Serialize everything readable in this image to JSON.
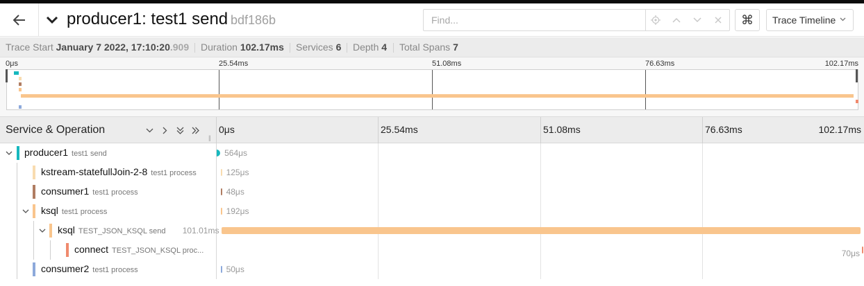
{
  "header": {
    "title": "producer1: test1 send",
    "trace_id": "bdf186b",
    "find_placeholder": "Find...",
    "kbd_symbol": "⌘",
    "view_selector": "Trace Timeline"
  },
  "stats": {
    "trace_start_label": "Trace Start",
    "trace_start_value": "January 7 2022, 17:10:20",
    "trace_start_ms": ".909",
    "duration_label": "Duration",
    "duration_value": "102.17ms",
    "services_label": "Services",
    "services_value": "6",
    "depth_label": "Depth",
    "depth_value": "4",
    "total_spans_label": "Total Spans",
    "total_spans_value": "7"
  },
  "minimap": {
    "ticks": [
      "0μs",
      "25.54ms",
      "51.08ms",
      "76.63ms",
      "102.17ms"
    ]
  },
  "timeline": {
    "column_title": "Service & Operation",
    "ticks": [
      "0μs",
      "25.54ms",
      "51.08ms",
      "76.63ms",
      "102.17ms"
    ]
  },
  "spans": [
    {
      "service": "producer1",
      "operation": "test1 send",
      "duration": "564μs",
      "color": "#17b8be",
      "start_pct": 0.0,
      "width_pct": 0.55
    },
    {
      "service": "kstream-statefullJoin-2-8",
      "operation": "test1 process",
      "duration": "125μs",
      "color": "#f8dcb0",
      "start_pct": 0.6,
      "width_pct": 0.12
    },
    {
      "service": "consumer1",
      "operation": "test1 process",
      "duration": "48μs",
      "color": "#b07d62",
      "start_pct": 0.6,
      "width_pct": 0.05
    },
    {
      "service": "ksql",
      "operation": "test1 process",
      "duration": "192μs",
      "color": "#f9c58d",
      "start_pct": 0.6,
      "width_pct": 0.19
    },
    {
      "service": "ksql",
      "operation": "TEST_JSON_KSQL send",
      "duration": "101.01ms",
      "color": "#f9c58d",
      "start_pct": 0.8,
      "width_pct": 98.86
    },
    {
      "service": "connect",
      "operation": "TEST_JSON_KSQL proc...",
      "duration": "70μs",
      "color": "#f08a6e",
      "start_pct": 99.93,
      "width_pct": 0.07
    },
    {
      "service": "consumer2",
      "operation": "test1 process",
      "duration": "50μs",
      "color": "#8da9db",
      "start_pct": 0.6,
      "width_pct": 0.05
    }
  ]
}
